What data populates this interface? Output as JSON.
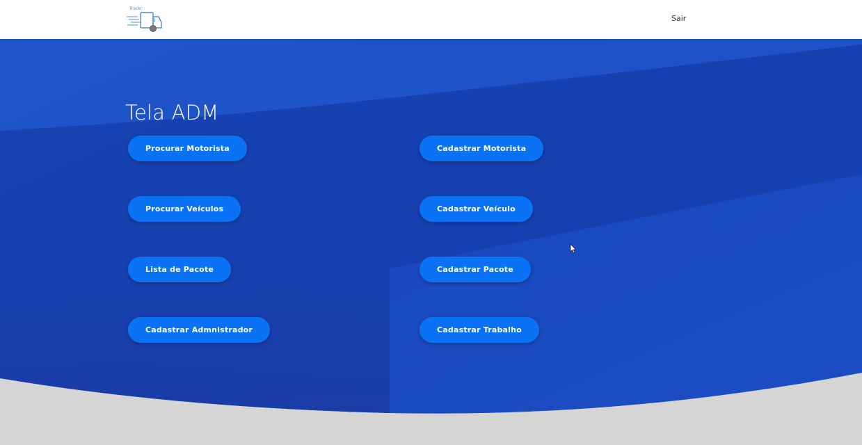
{
  "header": {
    "logo_text": "Trackr",
    "logout_label": "Sair"
  },
  "main": {
    "title": "Tela ADM",
    "buttons": {
      "procurar_motorista": "Procurar Motorista",
      "cadastrar_motorista": "Cadastrar Motorista",
      "procurar_veiculos": "Procurar Veículos",
      "cadastrar_veiculo": "Cadastrar Veículo",
      "lista_pacote": "Lista de Pacote",
      "cadastrar_pacote": "Cadastrar Pacote",
      "cadastrar_admnistrador": "Cadastrar Admnistrador",
      "cadastrar_trabalho": "Cadastrar Trabalho"
    }
  },
  "colors": {
    "hero_blue": "#1a47bd",
    "button_blue": "#0a73f5",
    "footer_gray": "#d3d3d3"
  }
}
